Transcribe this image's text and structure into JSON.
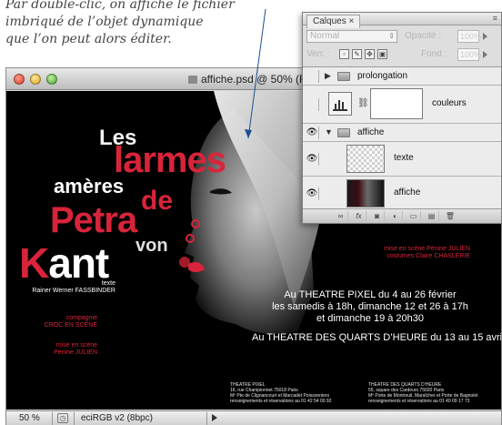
{
  "caption": {
    "line1": "Par double-clic, on affiche le fichier",
    "line2": "imbriqué de l’objet dynamique",
    "line3": "que l’on peut alors éditer."
  },
  "document": {
    "title": "affiche.psd @ 50% (R",
    "status": {
      "zoom": "50 %",
      "profile": "eciRGB v2 (8bpc)"
    }
  },
  "poster": {
    "title_words": {
      "les": "Les",
      "larmes": "larmes",
      "ameres": "amères",
      "de": "de",
      "petra": "Petra",
      "von": "von",
      "kant_k": "K",
      "kant_rest": "ant"
    },
    "texte_label": "texte",
    "author": "Rainer Werner FASSBINDER",
    "compagnie_label": "compagnie",
    "compagnie": "CROC EN SCÈNE",
    "mise_label": "mise en scène",
    "mise": "Pénine JULIEN",
    "right_credit_1": "mise en scène Pénine JULIEN",
    "right_credit_2": "costumes Claire CHASLERIE",
    "dates": {
      "line1": "Au THEATRE PIXEL du 4 au 26 février",
      "line2": "les samedis à 18h, dimanche 12 et 26 à 17h",
      "line3": "et dimanche 19 à 20h30",
      "line4": "Au THEATRE DES QUARTS D’HEURE du 13 au 15 avril à 21h"
    },
    "addr_left": {
      "l1": "THEATRE PIXEL",
      "l2": "16, rue Championnet 75018 Paris",
      "l3": "Mº Pte de Clignancourt et Marcadet Poissonniers",
      "l4": "renseignements et réservations au 01 42 54 00 92"
    },
    "addr_right": {
      "l1": "THEATRE DES QUARTS D’HEURE",
      "l2": "55, square des Cardeurs 75020 Paris",
      "l3": "Mº Porte de Montreuil, Maraîcher et Porte de Bagnolet",
      "l4": "renseignements et réservations au 01 40 09 17 73"
    }
  },
  "layers_panel": {
    "tab": "Calques",
    "tab_close": "×",
    "blend_mode": "Normal",
    "opacity_label": "Opacité :",
    "opacity_value": "100%",
    "lock_label": "Verr. :",
    "fill_label": "Fond :",
    "fill_value": "100%",
    "layers": [
      {
        "name": "prolongation",
        "kind": "group-collapsed"
      },
      {
        "name": "couleurs",
        "kind": "adjustment"
      },
      {
        "name": "affiche",
        "kind": "group-open"
      },
      {
        "name": "texte",
        "kind": "layer"
      },
      {
        "name": "affiche",
        "kind": "smart-object"
      }
    ],
    "footer_buttons": [
      "link-icon",
      "fx-icon",
      "mask-icon",
      "adjustment-icon",
      "folder-icon",
      "new-layer-icon",
      "trash-icon"
    ]
  },
  "colors": {
    "poster_red": "#d8243a",
    "poster_bg": "#000000",
    "panel_bg": "#dedede"
  }
}
